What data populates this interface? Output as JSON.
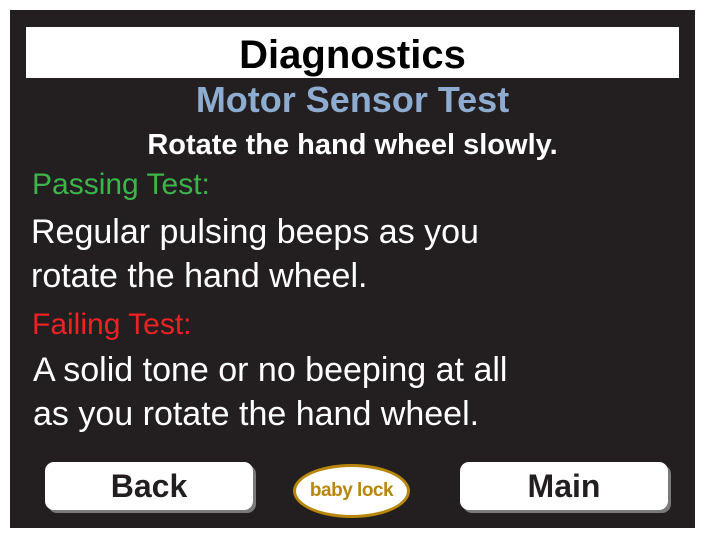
{
  "header": {
    "title": "Diagnostics"
  },
  "test": {
    "name": "Motor Sensor Test",
    "instruction": "Rotate the hand wheel slowly.",
    "passing": {
      "heading": "Passing Test:",
      "lines": [
        "Regular pulsing beeps as you",
        "rotate the hand wheel."
      ]
    },
    "failing": {
      "heading": "Failing Test:",
      "lines": [
        "A solid tone or no beeping at all",
        "as you rotate the hand wheel."
      ]
    }
  },
  "footer": {
    "back_label": "Back",
    "main_label": "Main",
    "logo_text": "baby lock"
  },
  "colors": {
    "background": "#231f20",
    "subtitle": "#8eabd0",
    "pass": "#3cb44a",
    "fail": "#ed2224",
    "logo": "#b8860b"
  }
}
